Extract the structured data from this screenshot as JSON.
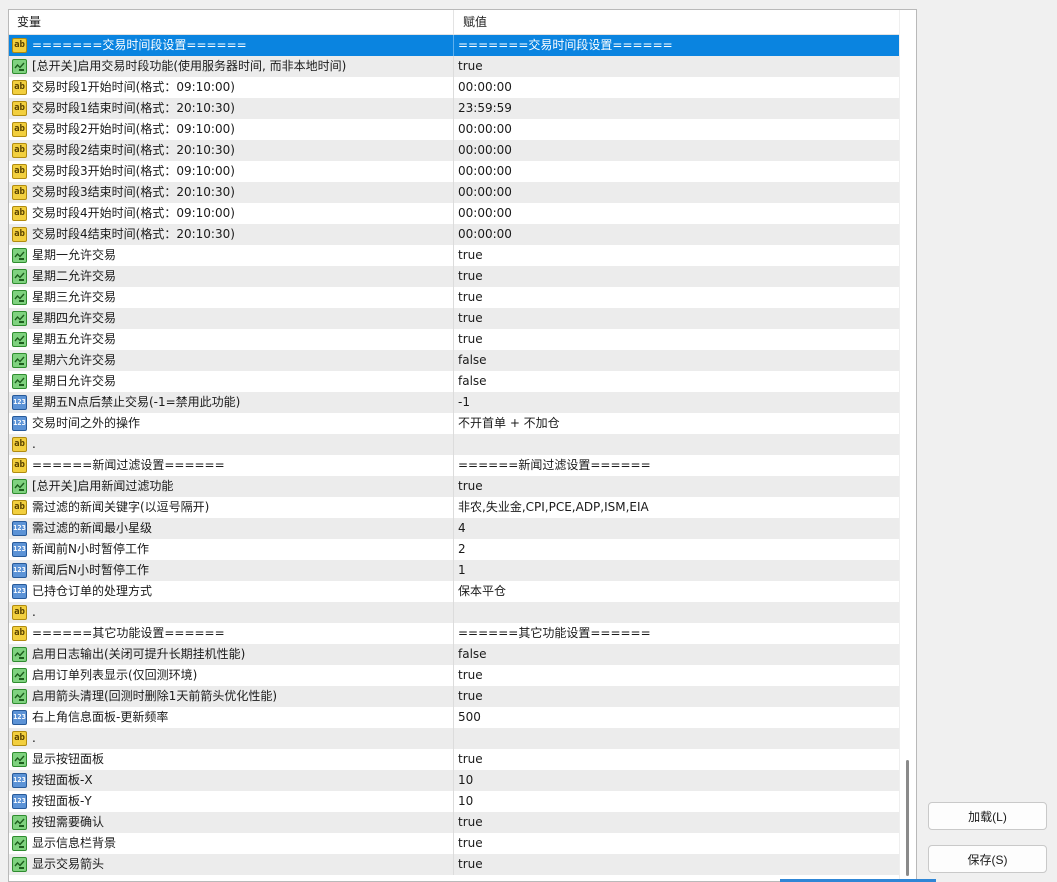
{
  "header": {
    "col_variable": "变量",
    "col_value": "赋值"
  },
  "rows": [
    {
      "type": "ab",
      "label": "=======交易时间段设置======",
      "value": "=======交易时间段设置======",
      "selected": true
    },
    {
      "type": "bool",
      "label": "[总开关]启用交易时段功能(使用服务器时间, 而非本地时间)",
      "value": "true"
    },
    {
      "type": "ab",
      "label": "交易时段1开始时间(格式：09:10:00)",
      "value": "00:00:00"
    },
    {
      "type": "ab",
      "label": "交易时段1结束时间(格式：20:10:30)",
      "value": "23:59:59"
    },
    {
      "type": "ab",
      "label": "交易时段2开始时间(格式：09:10:00)",
      "value": "00:00:00"
    },
    {
      "type": "ab",
      "label": "交易时段2结束时间(格式：20:10:30)",
      "value": "00:00:00"
    },
    {
      "type": "ab",
      "label": "交易时段3开始时间(格式：09:10:00)",
      "value": "00:00:00"
    },
    {
      "type": "ab",
      "label": "交易时段3结束时间(格式：20:10:30)",
      "value": "00:00:00"
    },
    {
      "type": "ab",
      "label": "交易时段4开始时间(格式：09:10:00)",
      "value": "00:00:00"
    },
    {
      "type": "ab",
      "label": "交易时段4结束时间(格式：20:10:30)",
      "value": "00:00:00"
    },
    {
      "type": "bool",
      "label": "星期一允许交易",
      "value": "true"
    },
    {
      "type": "bool",
      "label": "星期二允许交易",
      "value": "true"
    },
    {
      "type": "bool",
      "label": "星期三允许交易",
      "value": "true"
    },
    {
      "type": "bool",
      "label": "星期四允许交易",
      "value": "true"
    },
    {
      "type": "bool",
      "label": "星期五允许交易",
      "value": "true"
    },
    {
      "type": "bool",
      "label": "星期六允许交易",
      "value": "false"
    },
    {
      "type": "bool",
      "label": "星期日允许交易",
      "value": "false"
    },
    {
      "type": "num",
      "label": "星期五N点后禁止交易(-1=禁用此功能)",
      "value": "-1"
    },
    {
      "type": "num",
      "label": "交易时间之外的操作",
      "value": "不开首单 + 不加仓"
    },
    {
      "type": "ab",
      "label": ".",
      "value": ""
    },
    {
      "type": "ab",
      "label": "======新闻过滤设置======",
      "value": "======新闻过滤设置======"
    },
    {
      "type": "bool",
      "label": "[总开关]启用新闻过滤功能",
      "value": "true"
    },
    {
      "type": "ab",
      "label": "需过滤的新闻关键字(以逗号隔开)",
      "value": "非农,失业金,CPI,PCE,ADP,ISM,EIA"
    },
    {
      "type": "num",
      "label": "需过滤的新闻最小星级",
      "value": "4"
    },
    {
      "type": "num",
      "label": "新闻前N小时暂停工作",
      "value": "2"
    },
    {
      "type": "num",
      "label": "新闻后N小时暂停工作",
      "value": "1"
    },
    {
      "type": "num",
      "label": "已持仓订单的处理方式",
      "value": "保本平仓"
    },
    {
      "type": "ab",
      "label": ".",
      "value": ""
    },
    {
      "type": "ab",
      "label": "======其它功能设置======",
      "value": "======其它功能设置======"
    },
    {
      "type": "bool",
      "label": "启用日志输出(关闭可提升长期挂机性能)",
      "value": "false"
    },
    {
      "type": "bool",
      "label": "启用订单列表显示(仅回测环境)",
      "value": "true"
    },
    {
      "type": "bool",
      "label": "启用箭头清理(回测时删除1天前箭头优化性能)",
      "value": "true"
    },
    {
      "type": "num",
      "label": "右上角信息面板-更新频率",
      "value": "500"
    },
    {
      "type": "ab",
      "label": ".",
      "value": ""
    },
    {
      "type": "bool",
      "label": "显示按钮面板",
      "value": "true"
    },
    {
      "type": "num",
      "label": "按钮面板-X",
      "value": "10"
    },
    {
      "type": "num",
      "label": "按钮面板-Y",
      "value": "10"
    },
    {
      "type": "bool",
      "label": "按钮需要确认",
      "value": "true"
    },
    {
      "type": "bool",
      "label": "显示信息栏背景",
      "value": "true"
    },
    {
      "type": "bool",
      "label": "显示交易箭头",
      "value": "true"
    }
  ],
  "icons": {
    "ab": "ab",
    "bool": "",
    "num": "123"
  },
  "buttons": {
    "load": "加载(L)",
    "save": "保存(S)"
  },
  "colors": {
    "selected": "#0a84e0",
    "accent": "#2f86d6"
  }
}
